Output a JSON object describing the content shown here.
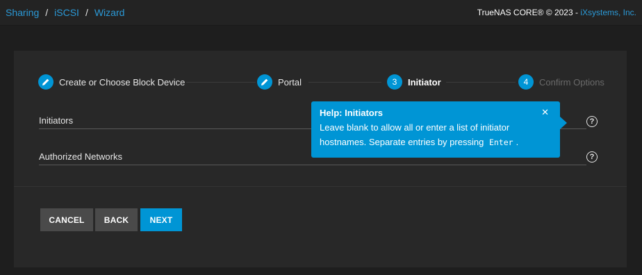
{
  "breadcrumb": {
    "items": [
      "Sharing",
      "iSCSI",
      "Wizard"
    ],
    "separator": "/"
  },
  "header": {
    "copyright_prefix": "TrueNAS CORE® © 2023 - ",
    "copyright_link": "iXsystems, Inc."
  },
  "stepper": {
    "steps": [
      {
        "number": "",
        "icon": "pencil-icon",
        "label": "Create or Choose Block Device",
        "state": "completed"
      },
      {
        "number": "",
        "icon": "pencil-icon",
        "label": "Portal",
        "state": "completed"
      },
      {
        "number": "3",
        "label": "Initiator",
        "state": "active"
      },
      {
        "number": "4",
        "label": "Confirm Options",
        "state": "inactive"
      }
    ]
  },
  "form": {
    "initiators_label": "Initiators",
    "authorized_networks_label": "Authorized Networks"
  },
  "help_popup": {
    "title": "Help: Initiators",
    "body_prefix": "Leave blank to allow all or enter a list of initiator hostnames. Separate entries by pressing",
    "code": "Enter",
    "body_suffix": ".",
    "close": "✕"
  },
  "buttons": {
    "cancel": "CANCEL",
    "back": "BACK",
    "next": "NEXT"
  },
  "colors": {
    "accent": "#0095d5",
    "link": "#2b9ad8",
    "background": "#1e1e1e",
    "card": "#282828"
  }
}
